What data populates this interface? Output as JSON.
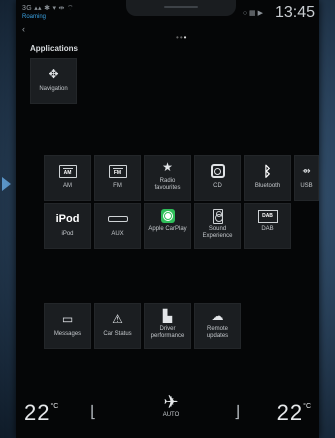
{
  "status": {
    "signal_text": "3G",
    "roaming": "Roaming",
    "time": "13:45"
  },
  "page": {
    "title": "Applications",
    "page_indicator": "3 pages, page 3 active"
  },
  "apps": {
    "navigation": {
      "label": "Navigation",
      "icon": "compass-icon"
    },
    "row1": [
      {
        "label": "AM",
        "icon": "radio-am-icon",
        "badge": "AM"
      },
      {
        "label": "FM",
        "icon": "radio-fm-icon",
        "badge": "FM"
      },
      {
        "label": "Radio favourites",
        "icon": "radio-favourites-icon"
      },
      {
        "label": "CD",
        "icon": "cd-icon"
      },
      {
        "label": "Bluetooth",
        "icon": "bluetooth-icon"
      },
      {
        "label": "USB",
        "icon": "usb-icon"
      }
    ],
    "row2": [
      {
        "label": "iPod",
        "icon": "ipod-icon",
        "badge": "iPod"
      },
      {
        "label": "AUX",
        "icon": "aux-icon"
      },
      {
        "label": "Apple CarPlay",
        "icon": "carplay-icon"
      },
      {
        "label": "Sound Experience",
        "icon": "speaker-icon"
      },
      {
        "label": "DAB",
        "icon": "dab-icon",
        "badge": "DAB"
      }
    ],
    "row3": [
      {
        "label": "Messages",
        "icon": "messages-icon"
      },
      {
        "label": "Car Status",
        "icon": "warning-icon"
      },
      {
        "label": "Driver performance",
        "icon": "driver-performance-icon"
      },
      {
        "label": "Remote updates",
        "icon": "cloud-download-icon"
      }
    ]
  },
  "climate": {
    "left_temp": "22",
    "right_temp": "22",
    "unit": "°C",
    "fan_mode": "AUTO"
  },
  "colors": {
    "carplay_green": "#2fbf5a",
    "roaming_blue": "#3aa0e0",
    "background": "#050607",
    "tile": "#1b1e21"
  }
}
